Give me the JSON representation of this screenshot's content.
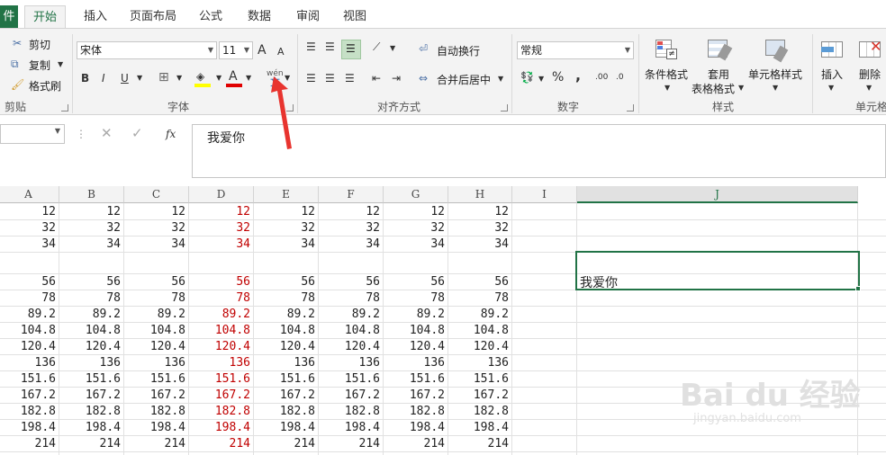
{
  "tabs": [
    {
      "label": "件"
    },
    {
      "label": "开始"
    },
    {
      "label": "插入"
    },
    {
      "label": "页面布局"
    },
    {
      "label": "公式"
    },
    {
      "label": "数据"
    },
    {
      "label": "审阅"
    },
    {
      "label": "视图"
    }
  ],
  "ribbon": {
    "clipboard": {
      "cut": "剪切",
      "copy": "复制",
      "format_painter": "格式刷",
      "label": "剪贴板"
    },
    "font": {
      "name": "宋体",
      "size": "11",
      "label": "字体",
      "bold": "B",
      "italic": "I",
      "underline": "U",
      "grow": "A",
      "shrink": "A",
      "phonetic": "wén"
    },
    "alignment": {
      "wrap": "自动换行",
      "merge": "合并后居中",
      "label": "对齐方式"
    },
    "number": {
      "format": "常规",
      "label": "数字",
      "percent": "%",
      "comma": ","
    },
    "styles": {
      "conditional": "条件格式",
      "table_line1": "套用",
      "table_line2": "表格格式",
      "cell_styles": "单元格样式",
      "label": "样式"
    },
    "cells": {
      "insert": "插入",
      "delete": "删除",
      "label": "单元格"
    }
  },
  "formula_bar": {
    "value": "我爱你",
    "fx": "fx"
  },
  "columns": [
    "A",
    "B",
    "C",
    "D",
    "E",
    "F",
    "G",
    "H",
    "I",
    "J"
  ],
  "selected_column": "J",
  "rows": [
    [
      "12",
      "12",
      "12",
      "12",
      "12",
      "12",
      "12",
      "12"
    ],
    [
      "32",
      "32",
      "32",
      "32",
      "32",
      "32",
      "32",
      "32"
    ],
    [
      "34",
      "34",
      "34",
      "34",
      "34",
      "34",
      "34",
      "34"
    ],
    [
      "",
      "",
      "",
      "",
      "",
      "",
      "",
      ""
    ],
    [
      "56",
      "56",
      "56",
      "56",
      "56",
      "56",
      "56",
      "56"
    ],
    [
      "78",
      "78",
      "78",
      "78",
      "78",
      "78",
      "78",
      "78"
    ],
    [
      "89.2",
      "89.2",
      "89.2",
      "89.2",
      "89.2",
      "89.2",
      "89.2",
      "89.2"
    ],
    [
      "104.8",
      "104.8",
      "104.8",
      "104.8",
      "104.8",
      "104.8",
      "104.8",
      "104.8"
    ],
    [
      "120.4",
      "120.4",
      "120.4",
      "120.4",
      "120.4",
      "120.4",
      "120.4",
      "120.4"
    ],
    [
      "136",
      "136",
      "136",
      "136",
      "136",
      "136",
      "136",
      "136"
    ],
    [
      "151.6",
      "151.6",
      "151.6",
      "151.6",
      "151.6",
      "151.6",
      "151.6",
      "151.6"
    ],
    [
      "167.2",
      "167.2",
      "167.2",
      "167.2",
      "167.2",
      "167.2",
      "167.2",
      "167.2"
    ],
    [
      "182.8",
      "182.8",
      "182.8",
      "182.8",
      "182.8",
      "182.8",
      "182.8",
      "182.8"
    ],
    [
      "198.4",
      "198.4",
      "198.4",
      "198.4",
      "198.4",
      "198.4",
      "198.4",
      "198.4"
    ],
    [
      "214",
      "214",
      "214",
      "214",
      "214",
      "214",
      "214",
      "214"
    ]
  ],
  "red_column": "D",
  "selected_cell_text": "我爱你",
  "watermark": {
    "main": "Bai du 经验",
    "sub": "jingyan.baidu.com"
  },
  "colors": {
    "accent": "#217346",
    "red_text": "#c00000",
    "arrow": "#e8342f"
  }
}
